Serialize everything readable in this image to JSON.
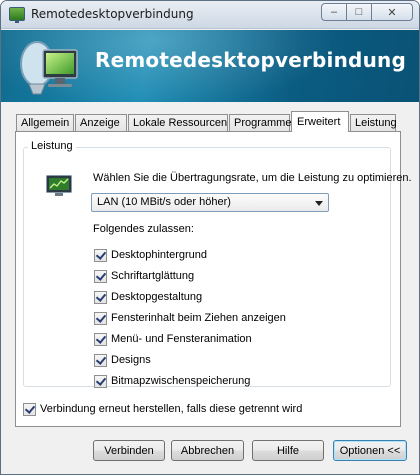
{
  "window": {
    "title": "Remotedesktopverbindung",
    "minimize_glyph": "–",
    "maximize_glyph": "□",
    "close_glyph": "✕"
  },
  "banner": {
    "title": "Remotedesktopverbindung"
  },
  "tabs": [
    {
      "label": "Allgemein",
      "active": false
    },
    {
      "label": "Anzeige",
      "active": false
    },
    {
      "label": "Lokale Ressourcen",
      "active": false
    },
    {
      "label": "Programme",
      "active": false
    },
    {
      "label": "Erweitert",
      "active": true
    },
    {
      "label": "Leistung",
      "active": false
    }
  ],
  "performance": {
    "group_label": "Leistung",
    "description": "Wählen Sie die Übertragungsrate, um die Leistung zu optimieren.",
    "connection_speed": "LAN (10 MBit/s oder höher)",
    "allow_label": "Folgendes zulassen:",
    "options": [
      {
        "label": "Desktophintergrund",
        "checked": true
      },
      {
        "label": "Schriftartglättung",
        "checked": true
      },
      {
        "label": "Desktopgestaltung",
        "checked": true
      },
      {
        "label": "Fensterinhalt beim Ziehen anzeigen",
        "checked": true
      },
      {
        "label": "Menü- und Fensteranimation",
        "checked": true
      },
      {
        "label": "Designs",
        "checked": true
      },
      {
        "label": "Bitmapzwischenspeicherung",
        "checked": true
      }
    ]
  },
  "reconnect": {
    "label": "Verbindung erneut herstellen, falls diese getrennt wird",
    "checked": true
  },
  "buttons": {
    "connect": "Verbinden",
    "cancel": "Abbrechen",
    "help": "Hilfe",
    "options": "Optionen <<"
  },
  "colors": {
    "banner": "#1c8cb4",
    "checkmark": "#2a3e74"
  }
}
